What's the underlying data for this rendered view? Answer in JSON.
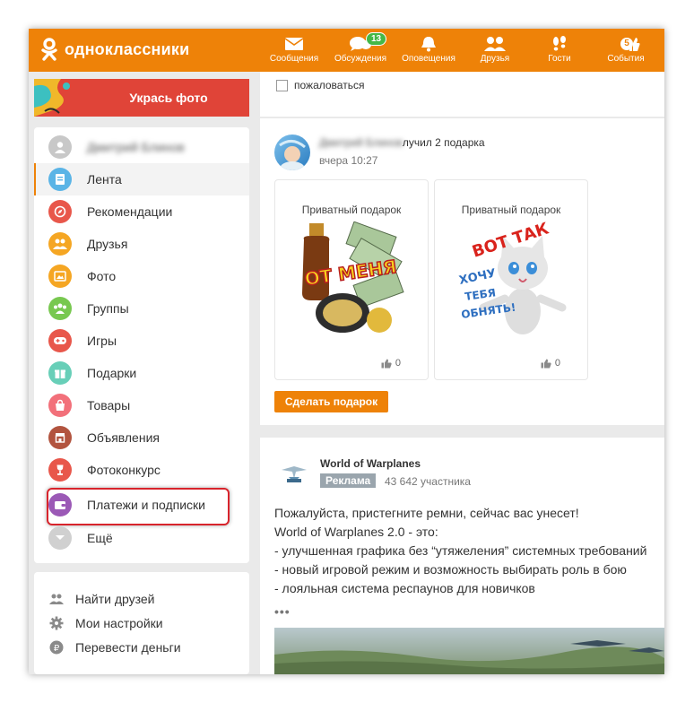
{
  "header": {
    "logo_text": "одноклассники",
    "nav": [
      {
        "label": "Сообщения",
        "icon": "envelope-icon"
      },
      {
        "label": "Обсуждения",
        "icon": "chat-bubbles-icon",
        "badge": "13"
      },
      {
        "label": "Оповещения",
        "icon": "bell-icon"
      },
      {
        "label": "Друзья",
        "icon": "friends-icon"
      },
      {
        "label": "Гости",
        "icon": "footprints-icon"
      },
      {
        "label": "События",
        "icon": "thumbs-up-icon",
        "badge": "5"
      }
    ]
  },
  "promo": {
    "label": "Укрась фото"
  },
  "sidebar": {
    "user_name": "Дмитрий Блинов",
    "items": [
      {
        "label": "Лента",
        "icon": "feed-icon",
        "color": "#5ab4e6"
      },
      {
        "label": "Рекомендации",
        "icon": "compass-icon",
        "color": "#e8574b"
      },
      {
        "label": "Друзья",
        "icon": "friends-icon",
        "color": "#f5a623"
      },
      {
        "label": "Фото",
        "icon": "photo-icon",
        "color": "#f5a623"
      },
      {
        "label": "Группы",
        "icon": "groups-icon",
        "color": "#78c850"
      },
      {
        "label": "Игры",
        "icon": "gamepad-icon",
        "color": "#e8574b"
      },
      {
        "label": "Подарки",
        "icon": "gift-icon",
        "color": "#68cfb8"
      },
      {
        "label": "Товары",
        "icon": "shopping-bag-icon",
        "color": "#f2707a"
      },
      {
        "label": "Объявления",
        "icon": "store-icon",
        "color": "#b2543f"
      },
      {
        "label": "Фотоконкурс",
        "icon": "trophy-icon",
        "color": "#e8574b"
      },
      {
        "label": "Платежи и подписки",
        "icon": "wallet-icon",
        "color": "#9b59b6"
      },
      {
        "label": "Ещё",
        "icon": "chevron-down-icon",
        "color": "#d0d0d0"
      }
    ],
    "secondary": [
      {
        "label": "Найти друзей",
        "icon": "find-friends-icon"
      },
      {
        "label": "Мои настройки",
        "icon": "gear-icon"
      },
      {
        "label": "Перевести деньги",
        "icon": "ruble-icon"
      }
    ]
  },
  "feed": {
    "complain_label": "пожаловаться",
    "post": {
      "author": "Дмитрий Блинов",
      "action": "лучил 2 подарка",
      "time": "вчера 10:27",
      "gifts": [
        {
          "title": "Приватный подарок",
          "likes": "0",
          "art_text": "ОТ МЕНЯ"
        },
        {
          "title": "Приватный подарок",
          "likes": "0",
          "art_text": [
            "ВОТ ТАК",
            "ХОЧУ",
            "ТЕБЯ",
            "ОБНЯТЬ!"
          ]
        }
      ],
      "gift_button": "Сделать подарок"
    },
    "ad": {
      "name": "World of Warplanes",
      "badge": "Реклама",
      "members": "43 642 участника",
      "lines": [
        "Пожалуйста, пристегните ремни, сейчас вас унесет!",
        "World of Warplanes 2.0 - это:",
        "- улучшенная графика без “утяжеления” системных требований",
        "- новый игровой режим и возможность выбирать роль в бою",
        "- лояльная система респаунов для новичков"
      ],
      "more": "•••"
    }
  },
  "colors": {
    "brand": "#ee8208",
    "highlight_border": "#d8242c",
    "badge_green": "#44b847"
  }
}
